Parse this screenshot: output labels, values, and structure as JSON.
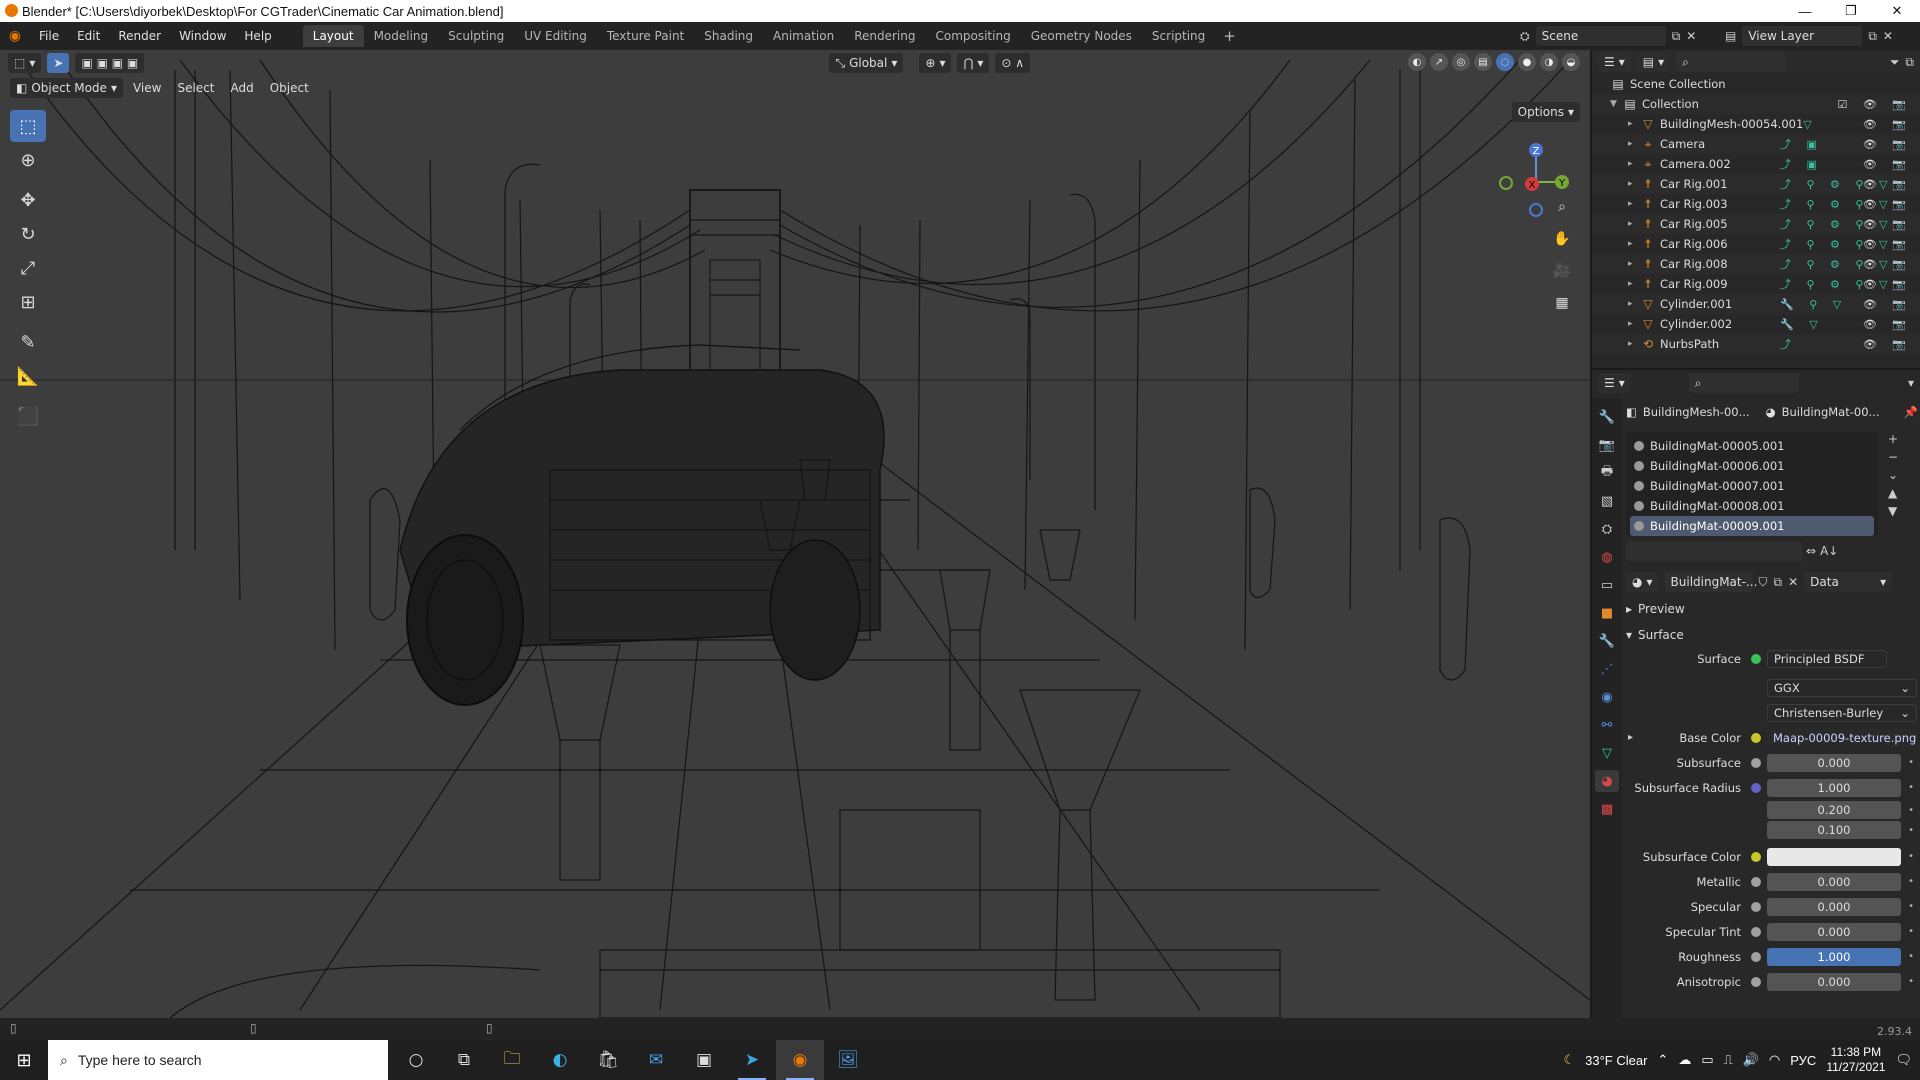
{
  "window": {
    "title": "Blender* [C:\\Users\\diyorbek\\Desktop\\For CGTrader\\Cinematic Car Animation.blend]",
    "controls": [
      "—",
      "❐",
      "✕"
    ]
  },
  "menu": [
    "File",
    "Edit",
    "Render",
    "Window",
    "Help"
  ],
  "workspaces": [
    {
      "label": "Layout",
      "active": true
    },
    {
      "label": "Modeling"
    },
    {
      "label": "Sculpting"
    },
    {
      "label": "UV Editing"
    },
    {
      "label": "Texture Paint"
    },
    {
      "label": "Shading"
    },
    {
      "label": "Animation"
    },
    {
      "label": "Rendering"
    },
    {
      "label": "Compositing"
    },
    {
      "label": "Geometry Nodes"
    },
    {
      "label": "Scripting"
    }
  ],
  "add_tab": "+",
  "scene": {
    "label": "Scene"
  },
  "view_layer": {
    "label": "View Layer"
  },
  "viewport": {
    "transform_orientation": "Global",
    "options": "Options",
    "mode": "Object Mode",
    "menus": [
      "View",
      "Select",
      "Add",
      "Object"
    ],
    "gizmo_axes": [
      "X",
      "Y",
      "Z"
    ],
    "tools": [
      "select-box",
      "cursor",
      "move",
      "rotate",
      "scale",
      "transform",
      "annotate",
      "measure",
      "add-cube"
    ]
  },
  "outliner": {
    "scene_collection": "Scene Collection",
    "collection": "Collection",
    "items": [
      {
        "name": "BuildingMesh-00054.001",
        "icon": "mesh",
        "mods": "▽"
      },
      {
        "name": "Camera",
        "icon": "camera",
        "mods": "⤴ ▣"
      },
      {
        "name": "Camera.002",
        "icon": "camera",
        "mods": "⤴ ▣"
      },
      {
        "name": "Car Rig.001",
        "icon": "armature",
        "mods": "⤴ ⚲ ⚙ ⚲ ▽"
      },
      {
        "name": "Car Rig.003",
        "icon": "armature",
        "mods": "⤴ ⚲ ⚙ ⚲ ▽"
      },
      {
        "name": "Car Rig.005",
        "icon": "armature",
        "mods": "⤴ ⚲ ⚙ ⚲ ▽"
      },
      {
        "name": "Car Rig.006",
        "icon": "armature",
        "mods": "⤴ ⚲ ⚙ ⚲ ▽"
      },
      {
        "name": "Car Rig.008",
        "icon": "armature",
        "mods": "⤴ ⚲ ⚙ ⚲ ▽"
      },
      {
        "name": "Car Rig.009",
        "icon": "armature",
        "mods": "⤴ ⚲ ⚙ ⚲ ▽"
      },
      {
        "name": "Cylinder.001",
        "icon": "mesh",
        "mods": "🔧 ⚲ ▽"
      },
      {
        "name": "Cylinder.002",
        "icon": "mesh",
        "mods": "🔧 ▽"
      },
      {
        "name": "NurbsPath",
        "icon": "curve",
        "mods": "⤴"
      }
    ]
  },
  "properties": {
    "object_crumb": "BuildingMesh-00...",
    "material_crumb": "BuildingMat-00...",
    "materials": [
      {
        "name": "BuildingMat-00005.001"
      },
      {
        "name": "BuildingMat-00006.001"
      },
      {
        "name": "BuildingMat-00007.001"
      },
      {
        "name": "BuildingMat-00008.001"
      },
      {
        "name": "BuildingMat-00009.001",
        "selected": true
      }
    ],
    "material_slot": "BuildingMat-...",
    "link_mode": "Data",
    "preview_label": "Preview",
    "surface_panel": "Surface",
    "surface": {
      "surface_label": "Surface",
      "shader": "Principled BSDF",
      "distribution": "GGX",
      "subsurface_method": "Christensen-Burley",
      "base_color_label": "Base Color",
      "base_color_texture": "Maap-00009-texture.png",
      "subsurface_label": "Subsurface",
      "subsurface": "0.000",
      "subsurface_radius_label": "Subsurface Radius",
      "subsurface_radius": [
        "1.000",
        "0.200",
        "0.100"
      ],
      "subsurface_color_label": "Subsurface Color",
      "metallic_label": "Metallic",
      "metallic": "0.000",
      "specular_label": "Specular",
      "specular": "0.000",
      "specular_tint_label": "Specular Tint",
      "specular_tint": "0.000",
      "roughness_label": "Roughness",
      "roughness": "1.000",
      "anisotropic_label": "Anisotropic",
      "anisotropic": "0.000"
    }
  },
  "status": {
    "version": "2.93.4"
  },
  "taskbar": {
    "search_placeholder": "Type here to search",
    "weather": "33°F  Clear",
    "language": "РУС",
    "time": "11:38 PM",
    "date": "11/27/2021"
  },
  "colors": {
    "accent": "#4772b3",
    "blender_orange": "#ea7600",
    "socket_yellow": "#c7c729",
    "socket_gray": "#a1a1a1",
    "socket_blue": "#6363c7"
  }
}
